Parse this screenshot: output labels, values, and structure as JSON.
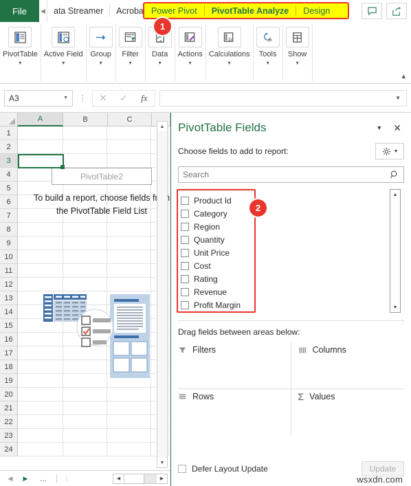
{
  "tabbar": {
    "file_label": "File",
    "scroll_left_icon": "chevron-left-icon",
    "tabs": [
      {
        "label": "ata Streamer"
      },
      {
        "label": "Acrobat"
      }
    ],
    "highlighted_tabs": [
      {
        "label": "Power Pivot",
        "bold": false
      },
      {
        "label": "PivotTable Analyze",
        "bold": true
      },
      {
        "label": "Design",
        "bold": false
      }
    ],
    "highlight_color": "#FFFF00",
    "highlight_border_color": "#E8362C",
    "comment_icon": "comment-icon",
    "share_icon": "share-icon"
  },
  "annotations": {
    "badge1": "1",
    "badge2": "2",
    "badge_color": "#E8362C"
  },
  "ribbon": {
    "groups": [
      {
        "label": "PivotTable",
        "icon": "pivottable-icon"
      },
      {
        "label": "Active Field",
        "icon": "active-field-icon"
      },
      {
        "label": "Group",
        "icon": "group-arrow-icon"
      },
      {
        "label": "Filter",
        "icon": "filter-icon"
      },
      {
        "label": "Data",
        "icon": "refresh-data-icon"
      },
      {
        "label": "Actions",
        "icon": "actions-icon"
      },
      {
        "label": "Calculations",
        "icon": "calculations-fx-icon"
      },
      {
        "label": "Tools",
        "icon": "tools-fx-icon"
      },
      {
        "label": "Show",
        "icon": "show-icon"
      }
    ],
    "collapse_icon": "chevron-up-icon"
  },
  "formula_bar": {
    "name_box_value": "A3",
    "cancel_icon": "close-icon",
    "confirm_icon": "check-icon",
    "function_icon": "fx-icon",
    "formula_value": "",
    "expand_icon": "chevron-down-icon"
  },
  "grid": {
    "columns": [
      "A",
      "B",
      "C"
    ],
    "active_column": "A",
    "active_row": "3",
    "rows": [
      "1",
      "2",
      "3",
      "4",
      "5",
      "6",
      "7",
      "8",
      "9",
      "10",
      "11",
      "12",
      "13",
      "14",
      "15",
      "16",
      "17",
      "18",
      "19",
      "20",
      "21",
      "22",
      "23",
      "24"
    ],
    "pivot_placeholder": "PivotTable2",
    "pivot_message": "To build a report, choose fields from the PivotTable Field List"
  },
  "sheet_bar": {
    "prev_icon": "triangle-left-icon",
    "next_icon": "triangle-right-icon",
    "more_sheets": "...",
    "grip_icon": "vertical-dots-icon"
  },
  "pane": {
    "title": "PivotTable Fields",
    "caret_icon": "chevron-down-icon",
    "close_icon": "close-icon",
    "choose_label": "Choose fields to add to report:",
    "gear_icon": "gear-icon",
    "gear_caret_icon": "chevron-down-icon",
    "search": {
      "placeholder": "Search",
      "value": "",
      "icon": "search-icon"
    },
    "fields": [
      {
        "label": "Product Id",
        "checked": false
      },
      {
        "label": "Category",
        "checked": false
      },
      {
        "label": "Region",
        "checked": false
      },
      {
        "label": "Quantity",
        "checked": false
      },
      {
        "label": "Unit Price",
        "checked": false
      },
      {
        "label": "Cost",
        "checked": false
      },
      {
        "label": "Rating",
        "checked": false
      },
      {
        "label": "Revenue",
        "checked": false
      },
      {
        "label": "Profit Margin",
        "checked": false
      }
    ],
    "field_box_border_color": "#E8362C",
    "drag_label": "Drag fields between areas below:",
    "areas": [
      {
        "name": "Filters",
        "icon": "filter-funnel-icon"
      },
      {
        "name": "Columns",
        "icon": "columns-icon"
      },
      {
        "name": "Rows",
        "icon": "rows-icon"
      },
      {
        "name": "Values",
        "icon": "sigma-icon"
      }
    ],
    "defer_label": "Defer Layout Update",
    "defer_checked": false,
    "update_button": "Update"
  },
  "watermark": "wsxdn.com"
}
